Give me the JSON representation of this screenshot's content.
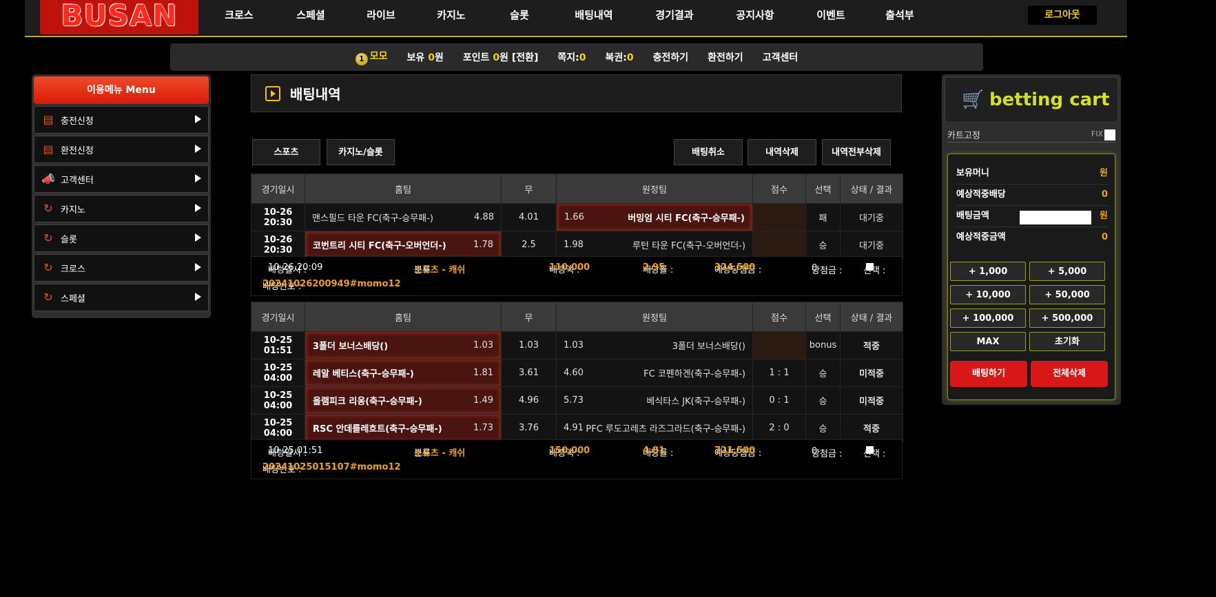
{
  "header": {
    "logo": "BUSAN",
    "nav": [
      "크로스",
      "스페셜",
      "라이브",
      "카지노",
      "슬롯",
      "배팅내역",
      "경기결과",
      "공지사항",
      "이벤트",
      "출석부"
    ],
    "logout": "로그아웃"
  },
  "infobar": {
    "level": "1",
    "nickname": "모모",
    "balance_label": "보유",
    "balance_value": "0",
    "balance_unit": "원",
    "point_label": "포인트",
    "point_value": "0",
    "point_unit": "원 [전환]",
    "note_label": "쪽지:",
    "note_value": "0",
    "ticket_label": "복권:",
    "ticket_value": "0",
    "deposit": "충전하기",
    "withdraw": "환전하기",
    "support": "고객센터"
  },
  "leftmenu": {
    "title": "이용메뉴   Menu",
    "items": [
      "충전신청",
      "환전신청",
      "고객센터",
      "카지노",
      "슬롯",
      "크로스",
      "스페셜"
    ]
  },
  "main": {
    "title": "배팅내역",
    "tab_sports": "스포츠",
    "tab_casino": "카지노/슬롯",
    "btn_cancel": "배팅취소",
    "btn_delete": "내역삭제",
    "btn_delete_all": "내역전부삭제",
    "columns": [
      "경기일시",
      "홈팀",
      "무",
      "원정팀",
      "점수",
      "선택",
      "상태 / 결과"
    ]
  },
  "bets": [
    {
      "rows": [
        {
          "date": "10-26 20:30",
          "home": "맨스필드 타운 FC(축구-승무패-)",
          "home_odds": "4.88",
          "draw": "4.01",
          "away_odds": "1.66",
          "away": "버밍엄 시티 FC(축구-승무패-)",
          "score": "",
          "pick": "패",
          "status": "대기중",
          "sel": "away"
        },
        {
          "date": "10-26 20:30",
          "home": "코번트리 시티 FC(축구-오버언더-)",
          "home_odds": "1.78",
          "draw": "2.5",
          "away_odds": "1.98",
          "away": "루턴 타운 FC(축구-오버언더-)",
          "score": "",
          "pick": "승",
          "status": "대기중",
          "sel": "home"
        }
      ],
      "summary": {
        "time_label": "배팅일시 : ",
        "time": "10-26 20:09",
        "cat_label": "분류 : ",
        "cat": "스포츠 - 캐쉬",
        "amount_label": "배팅액 : ",
        "amount": "110,000",
        "rate_label": "배당률 : ",
        "rate": "2.95",
        "expect_label": "예상당첨금 : ",
        "expect": "324,500",
        "win_label": "당첨금 : ",
        "win": "0",
        "select_label": "선택 : ",
        "id_label": "배팅번호 : ",
        "id": "20241026200949#momo12"
      }
    },
    {
      "rows": [
        {
          "date": "10-25 01:51",
          "home": "3폴더 보너스배당()",
          "home_odds": "1.03",
          "draw": "1.03",
          "away_odds": "1.03",
          "away": "3폴더 보너스배당()",
          "score": "",
          "pick": "bonus",
          "status": "적중",
          "sel": "home"
        },
        {
          "date": "10-25 04:00",
          "home": "레알 베티스(축구-승무패-)",
          "home_odds": "1.81",
          "draw": "3.61",
          "away_odds": "4.60",
          "away": "FC 코펜하겐(축구-승무패-)",
          "score": "1 : 1",
          "pick": "승",
          "status": "미적중",
          "sel": "home"
        },
        {
          "date": "10-25 04:00",
          "home": "올램피크 리옹(축구-승무패-)",
          "home_odds": "1.49",
          "draw": "4.96",
          "away_odds": "5.73",
          "away": "베식타스 JK(축구-승무패-)",
          "score": "0 : 1",
          "pick": "승",
          "status": "미적중",
          "sel": "home"
        },
        {
          "date": "10-25 04:00",
          "home": "RSC 안데를레흐트(축구-승무패-)",
          "home_odds": "1.73",
          "draw": "3.76",
          "away_odds": "4.91",
          "away": "PFC 루도고레츠 라즈그라드(축구-승무패-)",
          "score": "2 : 0",
          "pick": "승",
          "status": "적중",
          "sel": "home"
        }
      ],
      "summary": {
        "time_label": "배팅일시 : ",
        "time": "10-25 01:51",
        "cat_label": "분류 : ",
        "cat": "스포츠 - 캐쉬",
        "amount_label": "배팅액 : ",
        "amount": "150,000",
        "rate_label": "배당률 : ",
        "rate": "4.81",
        "expect_label": "예상당첨금 : ",
        "expect": "721,500",
        "win_label": "당첨금 : ",
        "win": "0",
        "select_label": "선택 : ",
        "id_label": "배팅번호 : ",
        "id": "20241025015107#momo12"
      }
    }
  ],
  "cart": {
    "title": "betting cart",
    "fix_label": "카트고정",
    "fix": "FIX",
    "rows": [
      {
        "label": "보유머니",
        "value": "원"
      },
      {
        "label": "예상적중배당",
        "value": "0"
      },
      {
        "label": "배팅금액",
        "value": "원"
      },
      {
        "label": "예상적중금액",
        "value": "0"
      }
    ],
    "buttons": [
      "+ 1,000",
      "+ 5,000",
      "+ 10,000",
      "+ 50,000",
      "+ 100,000",
      "+ 500,000",
      "MAX",
      "초기화"
    ],
    "bet": "배팅하기",
    "clear": "전체삭제"
  },
  "colors": {
    "accent_yellow": "#f0d020",
    "orange": "#f0a020",
    "red": "#d81818",
    "blue": "#38a8f0"
  }
}
